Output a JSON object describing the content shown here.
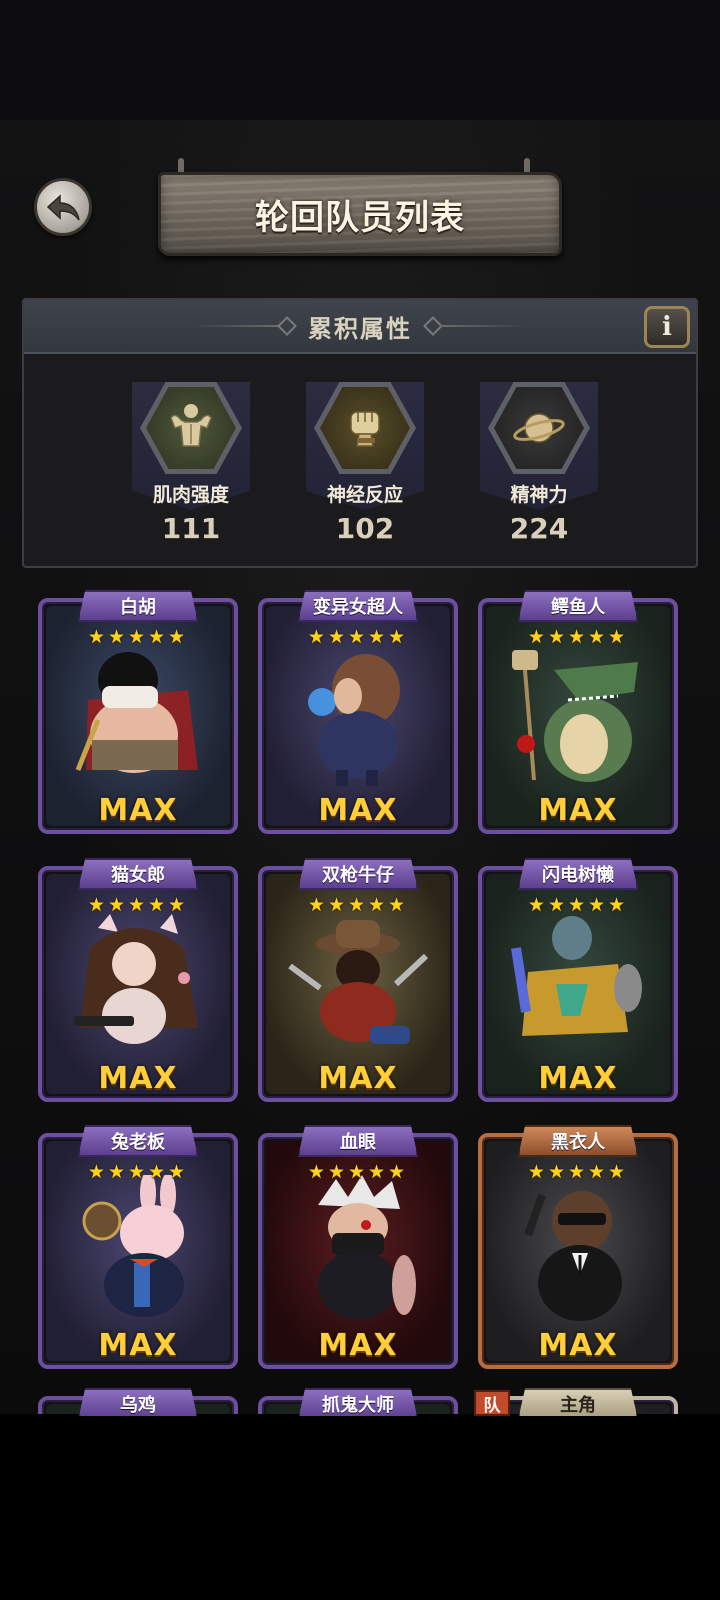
{
  "header": {
    "title": "轮回队员列表"
  },
  "attributes": {
    "title": "累积属性",
    "info_label": "i",
    "stats": [
      {
        "label": "肌肉强度",
        "value": "111",
        "icon": "muscle-icon"
      },
      {
        "label": "神经反应",
        "value": "102",
        "icon": "fist-icon"
      },
      {
        "label": "精神力",
        "value": "224",
        "icon": "planet-icon"
      }
    ]
  },
  "members": [
    {
      "name": "白胡",
      "stars": "★★★★★",
      "level": "MAX",
      "frame": "purple"
    },
    {
      "name": "变异女超人",
      "stars": "★★★★★",
      "level": "MAX",
      "frame": "purple"
    },
    {
      "name": "鳄鱼人",
      "stars": "★★★★★",
      "level": "MAX",
      "frame": "purple"
    },
    {
      "name": "猫女郎",
      "stars": "★★★★★",
      "level": "MAX",
      "frame": "purple"
    },
    {
      "name": "双枪牛仔",
      "stars": "★★★★★",
      "level": "MAX",
      "frame": "purple"
    },
    {
      "name": "闪电树懒",
      "stars": "★★★★★",
      "level": "MAX",
      "frame": "purple"
    },
    {
      "name": "兔老板",
      "stars": "★★★★★",
      "level": "MAX",
      "frame": "purple"
    },
    {
      "name": "血眼",
      "stars": "★★★★★",
      "level": "MAX",
      "frame": "purple"
    },
    {
      "name": "黑衣人",
      "stars": "★★★★★",
      "level": "MAX",
      "frame": "gold"
    }
  ],
  "partial_members": [
    {
      "name": "乌鸡"
    },
    {
      "name": "抓鬼大师"
    },
    {
      "name": "主角",
      "badge": "队"
    }
  ],
  "colors": {
    "accent_purple": "#6d4fa0",
    "accent_gold": "#b86d3f",
    "star_yellow": "#ffd21a",
    "max_yellow": "#ffcf3a"
  }
}
